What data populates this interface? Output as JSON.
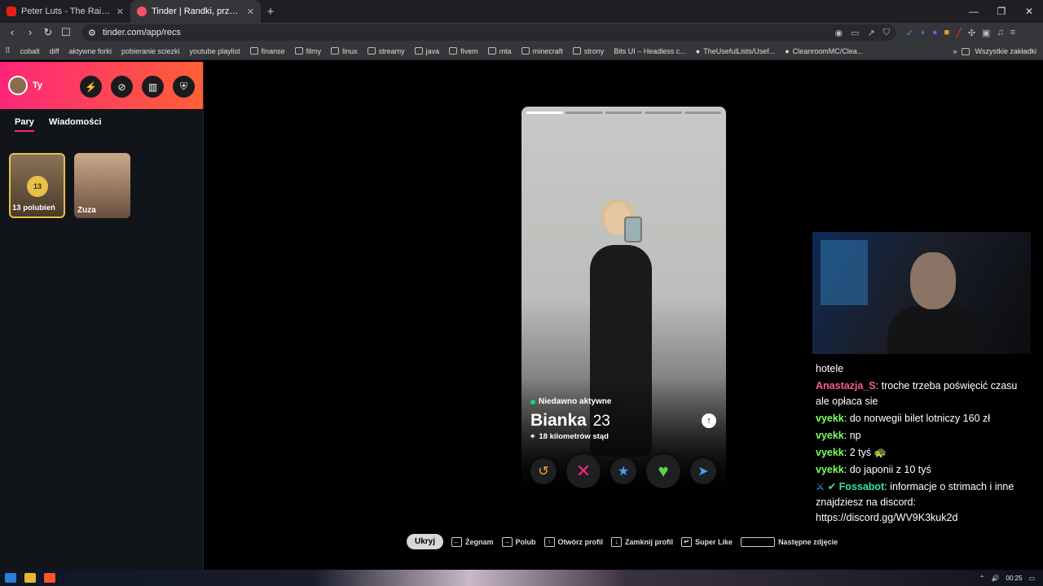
{
  "browser": {
    "tabs": [
      {
        "title": "Peter Luts - The Rain (Oski & Cita",
        "active": false
      },
      {
        "title": "Tinder | Randki, przyjaźni, nowe znajomości",
        "active": true
      }
    ],
    "url": "tinder.com/app/recs",
    "bookmarks": [
      "cobalt",
      "diff",
      "aktywne forki",
      "pobieranie sciezki",
      "youtube playlist",
      "finanse",
      "filmy",
      "linux",
      "streamy",
      "java",
      "fivem",
      "mta",
      "minecraft",
      "strony",
      "Bits UI – Headless c...",
      "TheUsefulLists/Usef...",
      "CleanroomMC/Clea..."
    ],
    "bookmarks_right": "Wszystkie zakładki"
  },
  "sidebar": {
    "user": "Ty",
    "tabs": [
      "Pary",
      "Wiadomości"
    ],
    "likes_count": "13",
    "likes_label": "13 polubień",
    "match_name": "Zuza"
  },
  "profile": {
    "status": "Niedawno aktywne",
    "name": "Bianka",
    "age": "23",
    "distance": "18 kilometrów stąd"
  },
  "hints": {
    "hide": "Ukryj",
    "nope": "Żegnam",
    "like": "Polub",
    "open": "Otwórz profil",
    "close": "Zamknij profil",
    "super": "Super Like",
    "next": "Następne zdjęcie"
  },
  "chat": {
    "partial": "hotele",
    "messages": [
      {
        "user": "Anastazja_S",
        "text": ": troche trzeba poświęcić czasu ale opłaca sie",
        "color": "#ff5c8a"
      },
      {
        "user": "vyekk",
        "text": ": do norwegii bilet lotniczy 160 zł",
        "color": "#7dff5c"
      },
      {
        "user": "vyekk",
        "text": ": np",
        "color": "#7dff5c"
      },
      {
        "user": "vyekk",
        "text": ": 2 tyś 🐢",
        "color": "#7dff5c"
      },
      {
        "user": "vyekk",
        "text": ": do japonii z 10 tyś",
        "color": "#7dff5c"
      },
      {
        "user": "Fossabot",
        "text": ": informacje o strimach i inne znajdziesz na discord: https://discord.gg/WV9K3kuk2d",
        "color": "#2ee6a8"
      }
    ]
  },
  "taskbar": {
    "time": "00:25"
  },
  "colors": {
    "brand_start": "#fd267a",
    "brand_end": "#ff6036",
    "online": "#21d07c"
  }
}
